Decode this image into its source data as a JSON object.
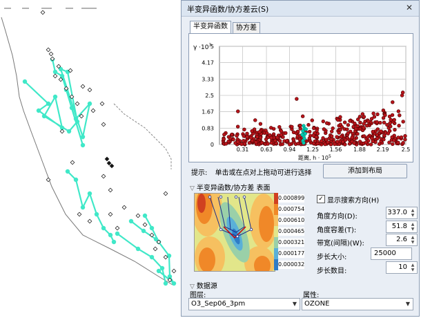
{
  "window": {
    "title": "半变异函数/协方差云(S)",
    "close_glyph": "✕"
  },
  "tabs": [
    {
      "label": "半变异函数",
      "active": true
    },
    {
      "label": "协方差",
      "active": false
    }
  ],
  "chart_data": {
    "type": "scatter",
    "ylabel_prefix": "γ ·10",
    "ylabel_exp": "3",
    "xlabel": "距离, h · 10",
    "xlabel_exp": "5",
    "xlim": [
      0,
      2.5
    ],
    "ylim": [
      0,
      5
    ],
    "x_ticks": [
      "0.31",
      "0.63",
      "0.94",
      "1.25",
      "1.56",
      "1.88",
      "2.19",
      "2.5"
    ],
    "y_ticks": [
      "0",
      "0.83",
      "1.67",
      "2.5",
      "3.33",
      "4.17",
      "5"
    ],
    "grid": true,
    "series": [
      {
        "color": "#b8141a",
        "stroke": "#4a0000"
      }
    ]
  },
  "hint": {
    "label": "提示:",
    "text": "单击或在点对上拖动可进行选择"
  },
  "buttons": {
    "add_to_layout": "添加到布局"
  },
  "surface_section": {
    "title": "半变异函数/协方差 表面",
    "legend": [
      "0.0008992",
      "0.0007548",
      "0.0006103",
      "0.0004659",
      "0.0003215",
      "0.0001771",
      "0.0000326"
    ],
    "legend_colors": [
      "#d04020",
      "#f08828",
      "#f6c060",
      "#e2e68a",
      "#9ad0a8",
      "#5ab0d8",
      "#2e7cc6"
    ]
  },
  "settings": {
    "show_direction": {
      "label": "显示搜索方向(H)",
      "checked": true
    },
    "angle_direction": {
      "label": "角度方向(D):",
      "value": "337.0"
    },
    "angle_tolerance": {
      "label": "角度容差(T):",
      "value": "51.8"
    },
    "bandwidth": {
      "label": "带宽(间隔)(W):",
      "value": "2.6"
    },
    "lag_size": {
      "label": "步长大小:",
      "value": "25000"
    },
    "lag_count": {
      "label": "步长数目:",
      "value": "10"
    }
  },
  "data_source": {
    "title": "数据源",
    "layer_label": "图层:",
    "layer_value": "O3_Sep06_3pm",
    "attribute_label": "属性:",
    "attribute_value": "OZONE"
  },
  "colors": {
    "accent": "#40e8c8",
    "selected_point": "#00c8b0"
  }
}
